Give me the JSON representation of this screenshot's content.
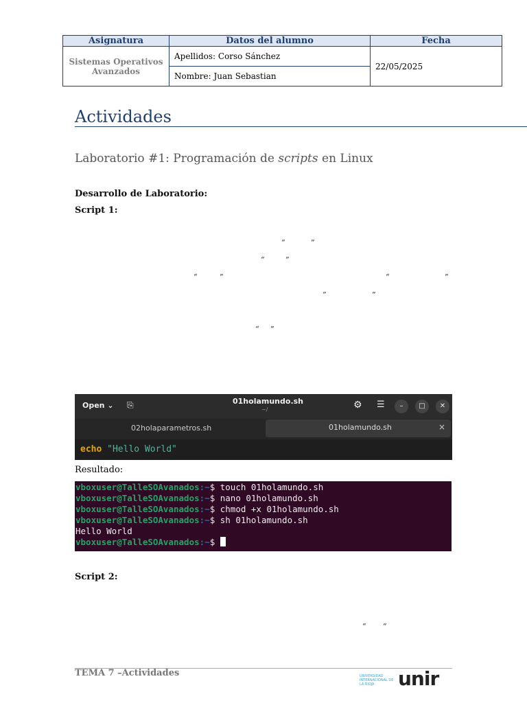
{
  "header": {
    "col_subject": "Asignatura",
    "col_student": "Datos del alumno",
    "col_date": "Fecha",
    "subject": "Sistemas Operativos Avanzados",
    "surname": "Apellidos: Corso Sánchez",
    "name": "Nombre: Juan Sebastian",
    "date": "22/05/2025"
  },
  "title": "Actividades",
  "lab_title_pre": "Laboratorio #1: Programación de ",
  "lab_title_em": "scripts",
  "lab_title_post": " en Linux",
  "dev_heading": "Desarrollo de Laboratorio:",
  "script1": "Script 1:",
  "quotes": [
    "“",
    "”"
  ],
  "editor": {
    "open": "Open",
    "title": "01holamundo.sh",
    "subtitle": "~/",
    "tab1": "02holaparametros.sh",
    "tab2": "01holamundo.sh",
    "close": "×",
    "code_kw": "echo",
    "code_str": "\"Hello World\""
  },
  "result_label": "Resultado:",
  "terminal": {
    "prompt": "vboxuser@TalleSOAvanados",
    "path": ":~",
    "lines": [
      "$ touch 01holamundo.sh",
      "$ nano 01holamundo.sh",
      "$ chmod +x 01holamundo.sh",
      "$ sh 01holamundo.sh"
    ],
    "output": "Hello World",
    "last": "$ "
  },
  "script2": "Script  2:",
  "footer": {
    "text": "TEMA 7 –Actividades",
    "logo_small": "UNIVERSIDAD INTERNACIONAL DE LA RIOJA",
    "logo": "unir"
  }
}
